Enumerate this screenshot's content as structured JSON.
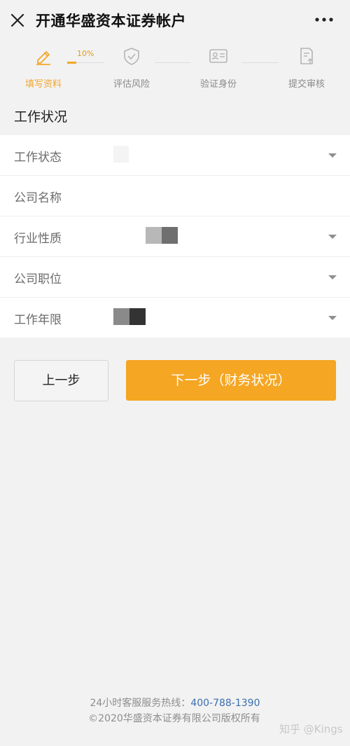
{
  "header": {
    "title": "开通华盛资本证券帐户"
  },
  "steps": {
    "progress_label": "10%",
    "items": [
      {
        "label": "填写资料",
        "icon": "pencil-icon",
        "active": true
      },
      {
        "label": "评估风险",
        "icon": "shield-check-icon",
        "active": false
      },
      {
        "label": "验证身份",
        "icon": "id-card-icon",
        "active": false
      },
      {
        "label": "提交审核",
        "icon": "document-upload-icon",
        "active": false
      }
    ]
  },
  "section_title": "工作状况",
  "form": {
    "fields": [
      {
        "label": "工作状态",
        "type": "select"
      },
      {
        "label": "公司名称",
        "type": "text"
      },
      {
        "label": "行业性质",
        "type": "select"
      },
      {
        "label": "公司职位",
        "type": "select"
      },
      {
        "label": "工作年限",
        "type": "select"
      }
    ]
  },
  "buttons": {
    "prev": "上一步",
    "next": "下一步（财务状况）"
  },
  "footer": {
    "hotline_label": "24小时客服服务热线：",
    "hotline_number": "400-788-1390",
    "copyright": "©2020华盛资本证券有限公司版权所有"
  },
  "watermark": "知乎 @Kings",
  "colors": {
    "accent": "#f5a623",
    "link": "#3a6fb0",
    "background": "#f2f2f2"
  }
}
